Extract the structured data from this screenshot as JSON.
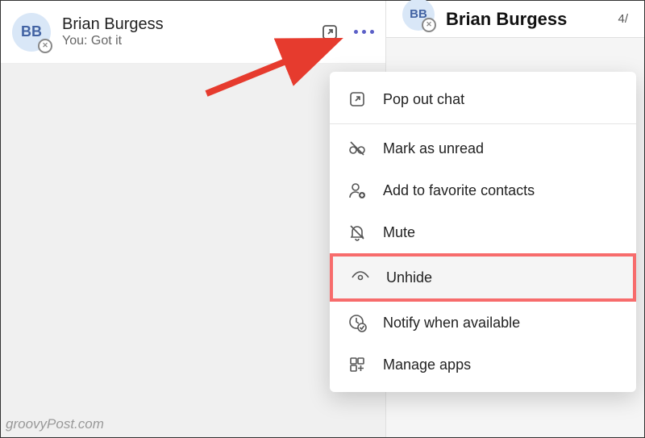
{
  "chat": {
    "avatar_initials": "BB",
    "name": "Brian Burgess",
    "preview": "You: Got it"
  },
  "right_header": {
    "avatar_initials": "BB",
    "name": "Brian Burgess",
    "date": "4/"
  },
  "menu": {
    "pop_out": "Pop out chat",
    "mark_unread": "Mark as unread",
    "add_favorite": "Add to favorite contacts",
    "mute": "Mute",
    "unhide": "Unhide",
    "notify": "Notify when available",
    "manage_apps": "Manage apps"
  },
  "watermark": "groovyPost.com"
}
